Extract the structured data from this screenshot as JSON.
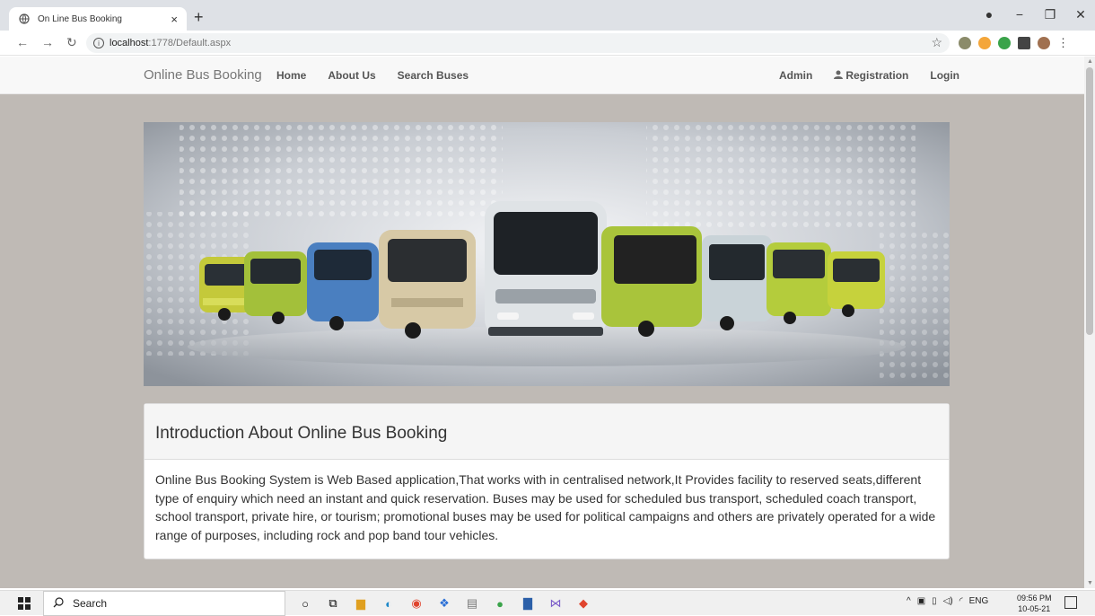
{
  "browser": {
    "tab_title": "On Line Bus Booking",
    "tab_close": "×",
    "new_tab": "+",
    "url_host": "localhost",
    "url_path": ":1778/Default.aspx",
    "window_controls": {
      "minimize": "−",
      "maximize": "❐",
      "close": "✕"
    }
  },
  "site": {
    "brand": "Online Bus Booking",
    "nav_left": [
      "Home",
      "About Us",
      "Search Buses"
    ],
    "nav_right": {
      "admin": "Admin",
      "registration": "Registration",
      "login": "Login"
    }
  },
  "panel": {
    "heading": "Introduction About Online Bus Booking",
    "body": "Online Bus Booking System is Web Based application,That works with in centralised network,It Provides facility to reserved seats,different type of enquiry which need an instant and quick reservation. Buses may be used for scheduled bus transport, scheduled coach transport, school transport, private hire, or tourism; promotional buses may be used for political campaigns and others are privately operated for a wide range of purposes, including rock and pop band tour vehicles."
  },
  "taskbar": {
    "search_label": "Search",
    "language": "ENG",
    "time": "09:56 PM",
    "date": "10-05-21"
  },
  "colors": {
    "page_background": "#bfbab5",
    "navbar_background": "#f8f8f8",
    "bus_green": "#a8c43a",
    "bus_blue": "#4a7fc0"
  }
}
